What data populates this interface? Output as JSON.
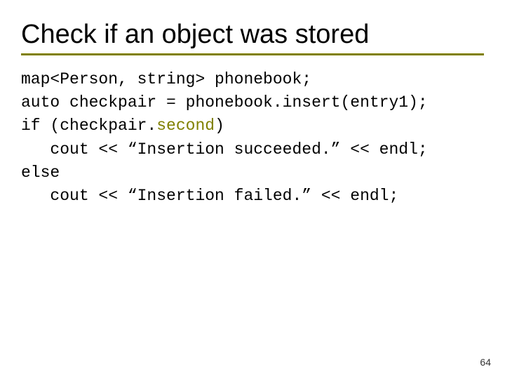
{
  "title": "Check if an object was stored",
  "code": {
    "l1": "map<Person, string> phonebook;",
    "l2": "auto checkpair = phonebook.insert(entry1);",
    "l3a": "if (checkpair.",
    "l3hl": "second",
    "l3b": ")",
    "l4": "   cout << “Insertion succeeded.” << endl;",
    "l5": "else",
    "l6": "   cout << “Insertion failed.” << endl;"
  },
  "page_number": "64"
}
